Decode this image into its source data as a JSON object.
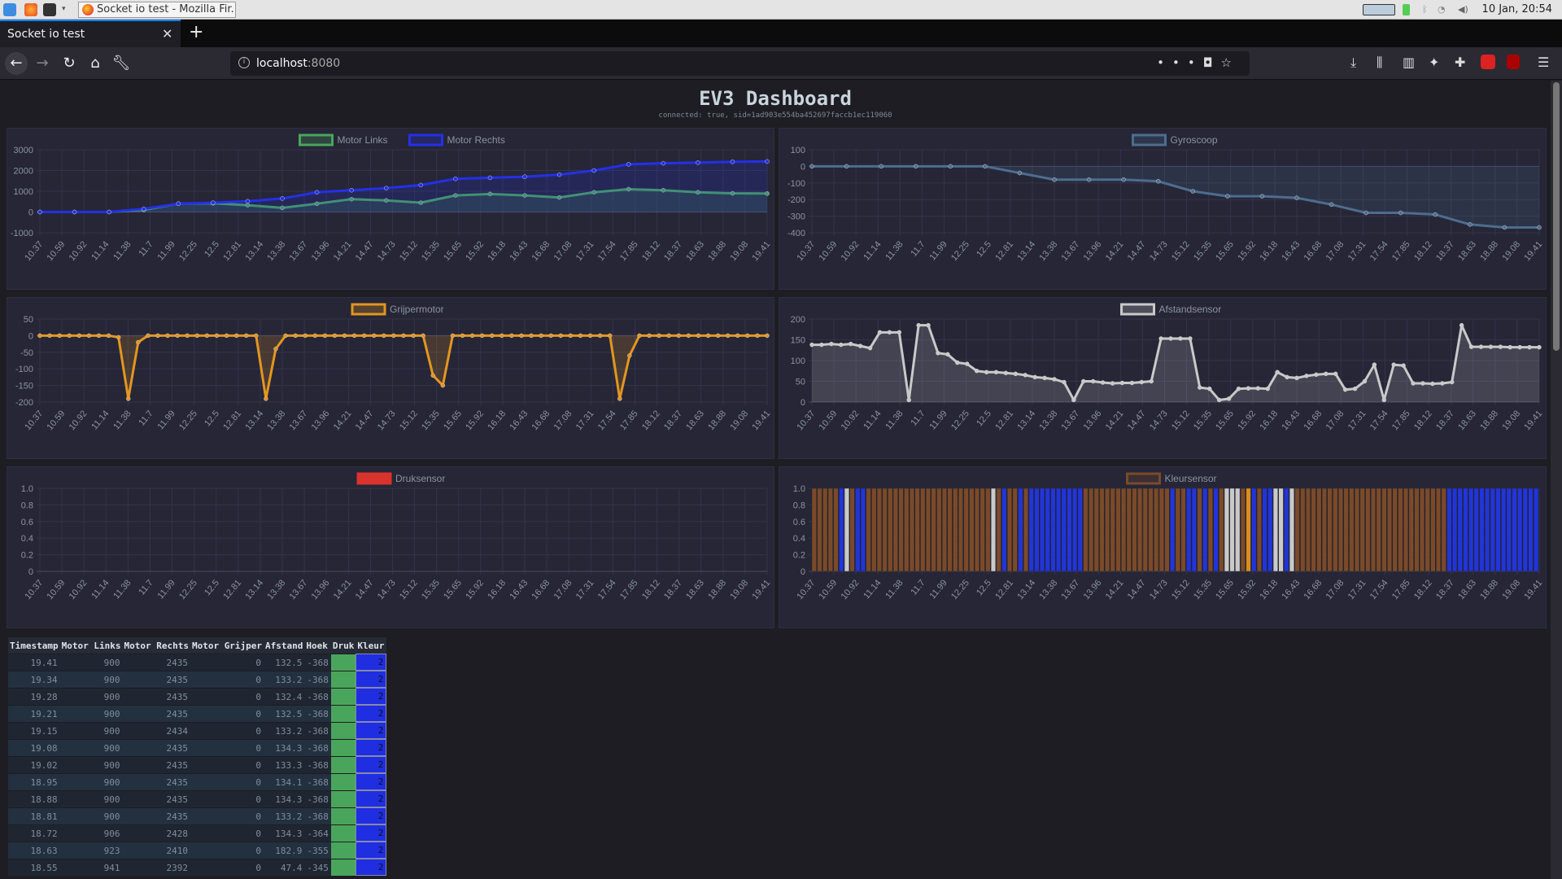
{
  "os": {
    "clock": "10 Jan, 20:54",
    "task_title": "Socket io test - Mozilla Fir..."
  },
  "browser": {
    "tab_title": "Socket io test",
    "url_host": "localhost",
    "url_port": ":8080"
  },
  "page": {
    "title": "EV3 Dashboard",
    "subtitle": "connected: true, sid=1ad903e554ba452697faccb1ec119060"
  },
  "timestamps": [
    "10.37",
    "10.59",
    "10.92",
    "11.14",
    "11.38",
    "11.7",
    "11.99",
    "12.25",
    "12.5",
    "12.81",
    "13.14",
    "13.38",
    "13.67",
    "13.96",
    "14.21",
    "14.47",
    "14.73",
    "15.12",
    "15.35",
    "15.65",
    "15.92",
    "16.18",
    "16.43",
    "16.68",
    "17.08",
    "17.31",
    "17.54",
    "17.85",
    "18.12",
    "18.37",
    "18.63",
    "18.88",
    "19.08",
    "19.41"
  ],
  "chart_data": [
    {
      "type": "line",
      "series": [
        {
          "name": "Motor Links",
          "color": "#4aa55c",
          "values": [
            0,
            0,
            0,
            100,
            400,
            420,
            330,
            200,
            400,
            620,
            560,
            450,
            800,
            870,
            800,
            700,
            950,
            1100,
            1050,
            950,
            900,
            890
          ]
        },
        {
          "name": "Motor Rechts",
          "color": "#2430e8",
          "values": [
            0,
            0,
            0,
            150,
            400,
            450,
            520,
            650,
            950,
            1050,
            1150,
            1300,
            1600,
            1650,
            1700,
            1800,
            2000,
            2300,
            2350,
            2380,
            2420,
            2435
          ]
        }
      ],
      "ylim": [
        -1000,
        3000
      ],
      "yticks": [
        3000,
        2000,
        1000,
        0,
        -1000
      ]
    },
    {
      "type": "line",
      "series": [
        {
          "name": "Gyroscoop",
          "color": "#4d6d8e",
          "values": [
            0,
            0,
            0,
            0,
            0,
            0,
            -40,
            -80,
            -80,
            -80,
            -90,
            -150,
            -180,
            -180,
            -190,
            -230,
            -280,
            -280,
            -290,
            -350,
            -368,
            -368
          ]
        }
      ],
      "ylim": [
        -400,
        100
      ],
      "yticks": [
        100,
        0,
        -100,
        -200,
        -300,
        -400
      ]
    },
    {
      "type": "line",
      "series": [
        {
          "name": "Grijpermotor",
          "color": "#e3961f",
          "values": [
            0,
            0,
            0,
            0,
            0,
            0,
            0,
            0,
            -5,
            -190,
            -20,
            0,
            0,
            0,
            0,
            0,
            0,
            0,
            0,
            0,
            0,
            0,
            0,
            -190,
            -40,
            0,
            0,
            0,
            0,
            0,
            0,
            0,
            0,
            0,
            0,
            0,
            0,
            0,
            0,
            0,
            -120,
            -150,
            0,
            0,
            0,
            0,
            0,
            0,
            0,
            0,
            0,
            0,
            0,
            0,
            0,
            0,
            0,
            0,
            0,
            -190,
            -60,
            0,
            0,
            0,
            0,
            0,
            0,
            0,
            0,
            0,
            0,
            0,
            0,
            0,
            0
          ]
        }
      ],
      "ylim": [
        -200,
        50
      ],
      "yticks": [
        50,
        0,
        -50,
        -100,
        -150,
        -200
      ]
    },
    {
      "type": "line",
      "series": [
        {
          "name": "Afstandsensor",
          "color": "#c9c9c9",
          "values": [
            138,
            138,
            140,
            138,
            140,
            135,
            130,
            168,
            168,
            168,
            5,
            185,
            185,
            118,
            115,
            95,
            92,
            75,
            72,
            72,
            70,
            68,
            65,
            60,
            58,
            55,
            48,
            5,
            50,
            50,
            47,
            45,
            46,
            46,
            48,
            50,
            153,
            153,
            153,
            153,
            35,
            32,
            5,
            8,
            32,
            33,
            33,
            32,
            72,
            60,
            58,
            63,
            66,
            68,
            68,
            30,
            32,
            50,
            90,
            5,
            90,
            88,
            45,
            45,
            44,
            45,
            48,
            185,
            133,
            133,
            133,
            133,
            132,
            132,
            132,
            132
          ]
        }
      ],
      "ylim": [
        0,
        200
      ],
      "yticks": [
        200,
        150,
        100,
        50,
        0
      ]
    },
    {
      "type": "bar",
      "series": [
        {
          "name": "Druksensor",
          "color": "#d9332d",
          "values": []
        }
      ],
      "ylim": [
        0,
        1.0
      ],
      "yticks": [
        1.0,
        0.8,
        0.6,
        0.4,
        0.2,
        0
      ]
    },
    {
      "type": "bar",
      "series": [
        {
          "name": "Kleursensor",
          "color": "#7a4a2a",
          "values": [
            "b",
            "b",
            "b",
            "b",
            "b",
            "B",
            "w",
            "b",
            "B",
            "B",
            "b",
            "b",
            "b",
            "b",
            "b",
            "b",
            "b",
            "b",
            "b",
            "b",
            "b",
            "b",
            "b",
            "b",
            "b",
            "b",
            "b",
            "b",
            "b",
            "b",
            "b",
            "b",
            "b",
            "w",
            "b",
            "B",
            "b",
            "b",
            "B",
            "b",
            "B",
            "B",
            "B",
            "B",
            "B",
            "B",
            "B",
            "B",
            "B",
            "B",
            "b",
            "b",
            "b",
            "b",
            "b",
            "b",
            "b",
            "b",
            "b",
            "b",
            "b",
            "b",
            "b",
            "b",
            "b",
            "b",
            "B",
            "b",
            "b",
            "B",
            "B",
            "b",
            "B",
            "b",
            "B",
            "b",
            "w",
            "w",
            "w",
            "b",
            "y",
            "B",
            "b",
            "B",
            "B",
            "w",
            "w",
            "B",
            "w",
            "b",
            "b",
            "b",
            "b",
            "b",
            "b",
            "b",
            "b",
            "b",
            "b",
            "b",
            "b",
            "b",
            "b",
            "b",
            "b",
            "b",
            "b",
            "b",
            "b",
            "b",
            "b",
            "b",
            "b",
            "b",
            "b",
            "b",
            "b",
            "B",
            "B",
            "B",
            "B",
            "B",
            "B",
            "B",
            "B",
            "B",
            "B",
            "B",
            "B",
            "B",
            "B",
            "B",
            "B",
            "B"
          ]
        }
      ],
      "ylim": [
        0,
        1.0
      ],
      "yticks": [
        1.0,
        0.8,
        0.6,
        0.4,
        0.2,
        0
      ]
    }
  ],
  "table": {
    "headers": [
      "Timestamp",
      "Motor Links",
      "Motor Rechts",
      "Motor Grijper",
      "Afstand",
      "Hoek",
      "Druk",
      "Kleur"
    ],
    "rows": [
      [
        "19.41",
        "900",
        "2435",
        "0",
        "132.5",
        "-368",
        "",
        "2"
      ],
      [
        "19.34",
        "900",
        "2435",
        "0",
        "133.2",
        "-368",
        "",
        "2"
      ],
      [
        "19.28",
        "900",
        "2435",
        "0",
        "132.4",
        "-368",
        "",
        "2"
      ],
      [
        "19.21",
        "900",
        "2435",
        "0",
        "132.5",
        "-368",
        "",
        "2"
      ],
      [
        "19.15",
        "900",
        "2434",
        "0",
        "133.2",
        "-368",
        "",
        "2"
      ],
      [
        "19.08",
        "900",
        "2435",
        "0",
        "134.3",
        "-368",
        "",
        "2"
      ],
      [
        "19.02",
        "900",
        "2435",
        "0",
        "133.3",
        "-368",
        "",
        "2"
      ],
      [
        "18.95",
        "900",
        "2435",
        "0",
        "134.1",
        "-368",
        "",
        "2"
      ],
      [
        "18.88",
        "900",
        "2435",
        "0",
        "134.3",
        "-368",
        "",
        "2"
      ],
      [
        "18.81",
        "900",
        "2435",
        "0",
        "133.2",
        "-368",
        "",
        "2"
      ],
      [
        "18.72",
        "906",
        "2428",
        "0",
        "134.3",
        "-364",
        "",
        "2"
      ],
      [
        "18.63",
        "923",
        "2410",
        "0",
        "182.9",
        "-355",
        "",
        "2"
      ],
      [
        "18.55",
        "941",
        "2392",
        "0",
        "47.4",
        "-345",
        "",
        "2"
      ]
    ]
  }
}
